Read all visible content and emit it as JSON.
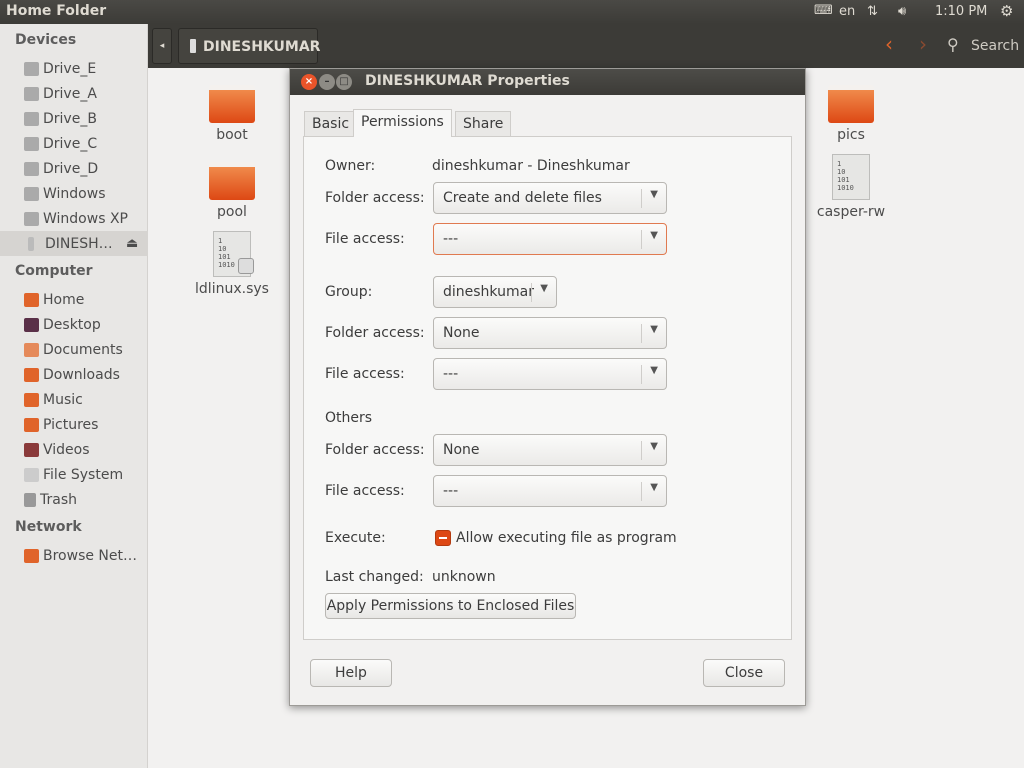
{
  "panel": {
    "title": "Home Folder",
    "keyboard": "en",
    "clock": "1:10 PM"
  },
  "toolbar": {
    "location": "DINESHKUMAR",
    "search": "Search"
  },
  "sidebar": {
    "devices_header": "Devices",
    "devices": [
      "Drive_E",
      "Drive_A",
      "Drive_B",
      "Drive_C",
      "Drive_D",
      "Windows",
      "Windows XP",
      "DINESH…"
    ],
    "computer_header": "Computer",
    "computer": [
      "Home",
      "Desktop",
      "Documents",
      "Downloads",
      "Music",
      "Pictures",
      "Videos",
      "File System",
      "Trash"
    ],
    "network_header": "Network",
    "network": [
      "Browse Net…"
    ]
  },
  "files": [
    "boot",
    "pool",
    "ldlinux.sys",
    "pics",
    "casper-rw"
  ],
  "doc_icon_text": "1\n10\n101\n1010",
  "dialog": {
    "title": "DINESHKUMAR Properties",
    "tabs": [
      "Basic",
      "Permissions",
      "Share"
    ],
    "active_tab": "Permissions",
    "owner_label": "Owner:",
    "owner_value": "dineshkumar - Dineshkumar",
    "folder_access_label": "Folder access:",
    "file_access_label": "File access:",
    "owner_folder_access": "Create and delete files",
    "owner_file_access": "---",
    "group_label": "Group:",
    "group_value": "dineshkumar",
    "group_folder_access": "None",
    "group_file_access": "---",
    "others_label": "Others",
    "others_folder_access": "None",
    "others_file_access": "---",
    "execute_label": "Execute:",
    "execute_text": "Allow executing file as program",
    "execute_state": "indeterminate",
    "last_changed_label": "Last changed:",
    "last_changed_value": "unknown",
    "apply_button": "Apply Permissions to Enclosed Files",
    "help_button": "Help",
    "close_button": "Close"
  },
  "colors": {
    "accent": "#dd4814",
    "panel": "#3c3b37"
  }
}
